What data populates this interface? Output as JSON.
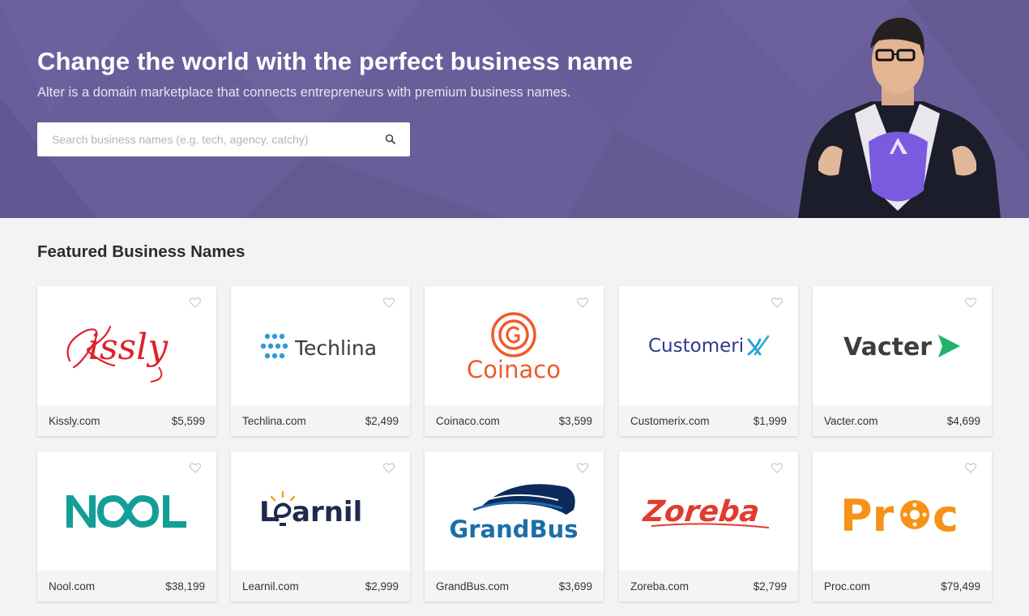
{
  "hero": {
    "title": "Change the world with the perfect business name",
    "subtitle": "Alter is a domain marketplace that connects entrepreneurs with premium business names.",
    "search_placeholder": "Search business names (e.g. tech, agency, catchy)",
    "search_icon": "search-icon",
    "background_color": "#6b5f9b"
  },
  "featured": {
    "title": "Featured Business Names",
    "cards": [
      {
        "domain": "Kissly.com",
        "price": "$5,599",
        "logo_text": "Kissly",
        "color": "#e0212d"
      },
      {
        "domain": "Techlina.com",
        "price": "$2,499",
        "logo_text": "Techlina",
        "color": "#3a3a3a",
        "accent": "#2f9bd6"
      },
      {
        "domain": "Coinaco.com",
        "price": "$3,599",
        "logo_text": "Coinaco",
        "color": "#ef5a28"
      },
      {
        "domain": "Customerix.com",
        "price": "$1,999",
        "logo_text": "Customerix",
        "color": "#2c3a8c",
        "accent": "#29a3d9"
      },
      {
        "domain": "Vacter.com",
        "price": "$4,699",
        "logo_text": "Vacter",
        "color": "#3d3d3d",
        "accent": "#21b36b"
      },
      {
        "domain": "Nool.com",
        "price": "$38,199",
        "logo_text": "NOOL",
        "color": "#139e96"
      },
      {
        "domain": "Learnil.com",
        "price": "$2,999",
        "logo_text": "Learnil",
        "color": "#1f2a4d",
        "accent": "#f2a51a"
      },
      {
        "domain": "GrandBus.com",
        "price": "$3,699",
        "logo_text": "GrandBus",
        "color": "#1b6fa8",
        "accent": "#0d2a5c"
      },
      {
        "domain": "Zoreba.com",
        "price": "$2,799",
        "logo_text": "Zoreba",
        "color": "#e23b2e"
      },
      {
        "domain": "Proc.com",
        "price": "$79,499",
        "logo_text": "Proc",
        "color": "#f79219"
      }
    ]
  }
}
